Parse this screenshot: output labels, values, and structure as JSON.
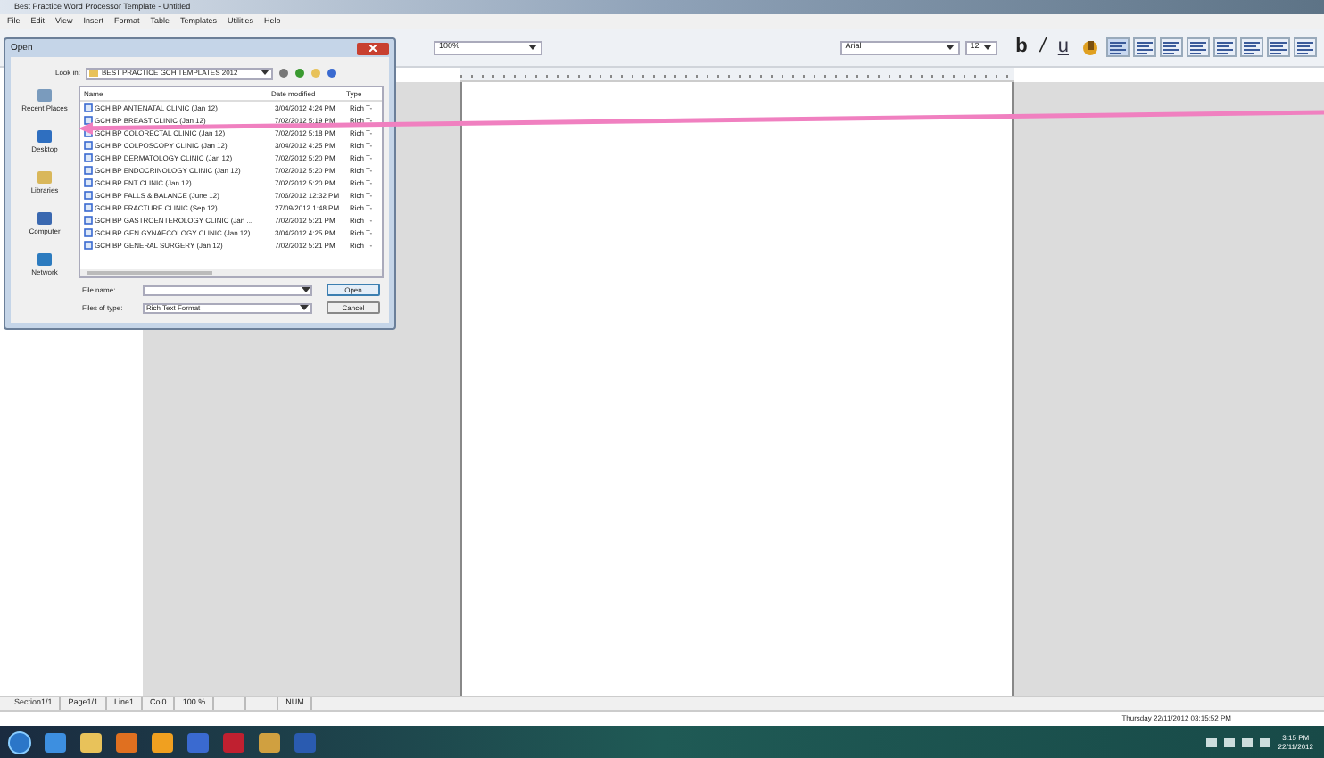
{
  "window": {
    "title": "Best Practice Word Processor Template - Untitled"
  },
  "menu": [
    "File",
    "Edit",
    "View",
    "Insert",
    "Format",
    "Table",
    "Templates",
    "Utilities",
    "Help"
  ],
  "toolbar": {
    "zoom": "100%",
    "font": "Arial",
    "size": "12",
    "format_buttons": [
      "b",
      "/",
      "u"
    ]
  },
  "open_dialog": {
    "title": "Open",
    "look_in_label": "Look in:",
    "look_in": "BEST PRACTICE GCH TEMPLATES 2012",
    "places": [
      "Recent Places",
      "Desktop",
      "Libraries",
      "Computer",
      "Network"
    ],
    "columns": [
      "Name",
      "Date modified",
      "Type"
    ],
    "files": [
      {
        "name": "GCH BP ANTENATAL CLINIC (Jan 12)",
        "date": "3/04/2012 4:24 PM",
        "type": "Rich T-"
      },
      {
        "name": "GCH BP BREAST CLINIC (Jan 12)",
        "date": "7/02/2012 5:19 PM",
        "type": "Rich T-"
      },
      {
        "name": "GCH BP COLORECTAL CLINIC (Jan 12)",
        "date": "7/02/2012 5:18 PM",
        "type": "Rich T-"
      },
      {
        "name": "GCH BP COLPOSCOPY CLINIC (Jan 12)",
        "date": "3/04/2012 4:25 PM",
        "type": "Rich T-"
      },
      {
        "name": "GCH BP DERMATOLOGY CLINIC (Jan 12)",
        "date": "7/02/2012 5:20 PM",
        "type": "Rich T-"
      },
      {
        "name": "GCH BP ENDOCRINOLOGY CLINIC (Jan 12)",
        "date": "7/02/2012 5:20 PM",
        "type": "Rich T-"
      },
      {
        "name": "GCH BP ENT CLINIC (Jan 12)",
        "date": "7/02/2012 5:20 PM",
        "type": "Rich T-"
      },
      {
        "name": "GCH BP FALLS & BALANCE (June 12)",
        "date": "7/06/2012 12:32 PM",
        "type": "Rich T-"
      },
      {
        "name": "GCH BP FRACTURE CLINIC (Sep 12)",
        "date": "27/09/2012 1:48 PM",
        "type": "Rich T-"
      },
      {
        "name": "GCH BP GASTROENTEROLOGY CLINIC (Jan ...",
        "date": "7/02/2012 5:21 PM",
        "type": "Rich T-"
      },
      {
        "name": "GCH BP GEN GYNAECOLOGY CLINIC (Jan 12)",
        "date": "3/04/2012 4:25 PM",
        "type": "Rich T-"
      },
      {
        "name": "GCH BP GENERAL SURGERY (Jan 12)",
        "date": "7/02/2012 5:21 PM",
        "type": "Rich T-"
      }
    ],
    "file_name_label": "File name:",
    "file_type_label": "Files of type:",
    "file_type": "Rich Text Format",
    "buttons": [
      "Open",
      "Cancel"
    ]
  },
  "status_bar": [
    "Section1/1",
    "Page1/1",
    "Line1",
    "Col0",
    "100 %",
    "NUM"
  ],
  "datetime": "Thursday 22/11/2012 03:15:52 PM",
  "tray": {
    "time": "3:15 PM",
    "date": "22/11/2012"
  }
}
